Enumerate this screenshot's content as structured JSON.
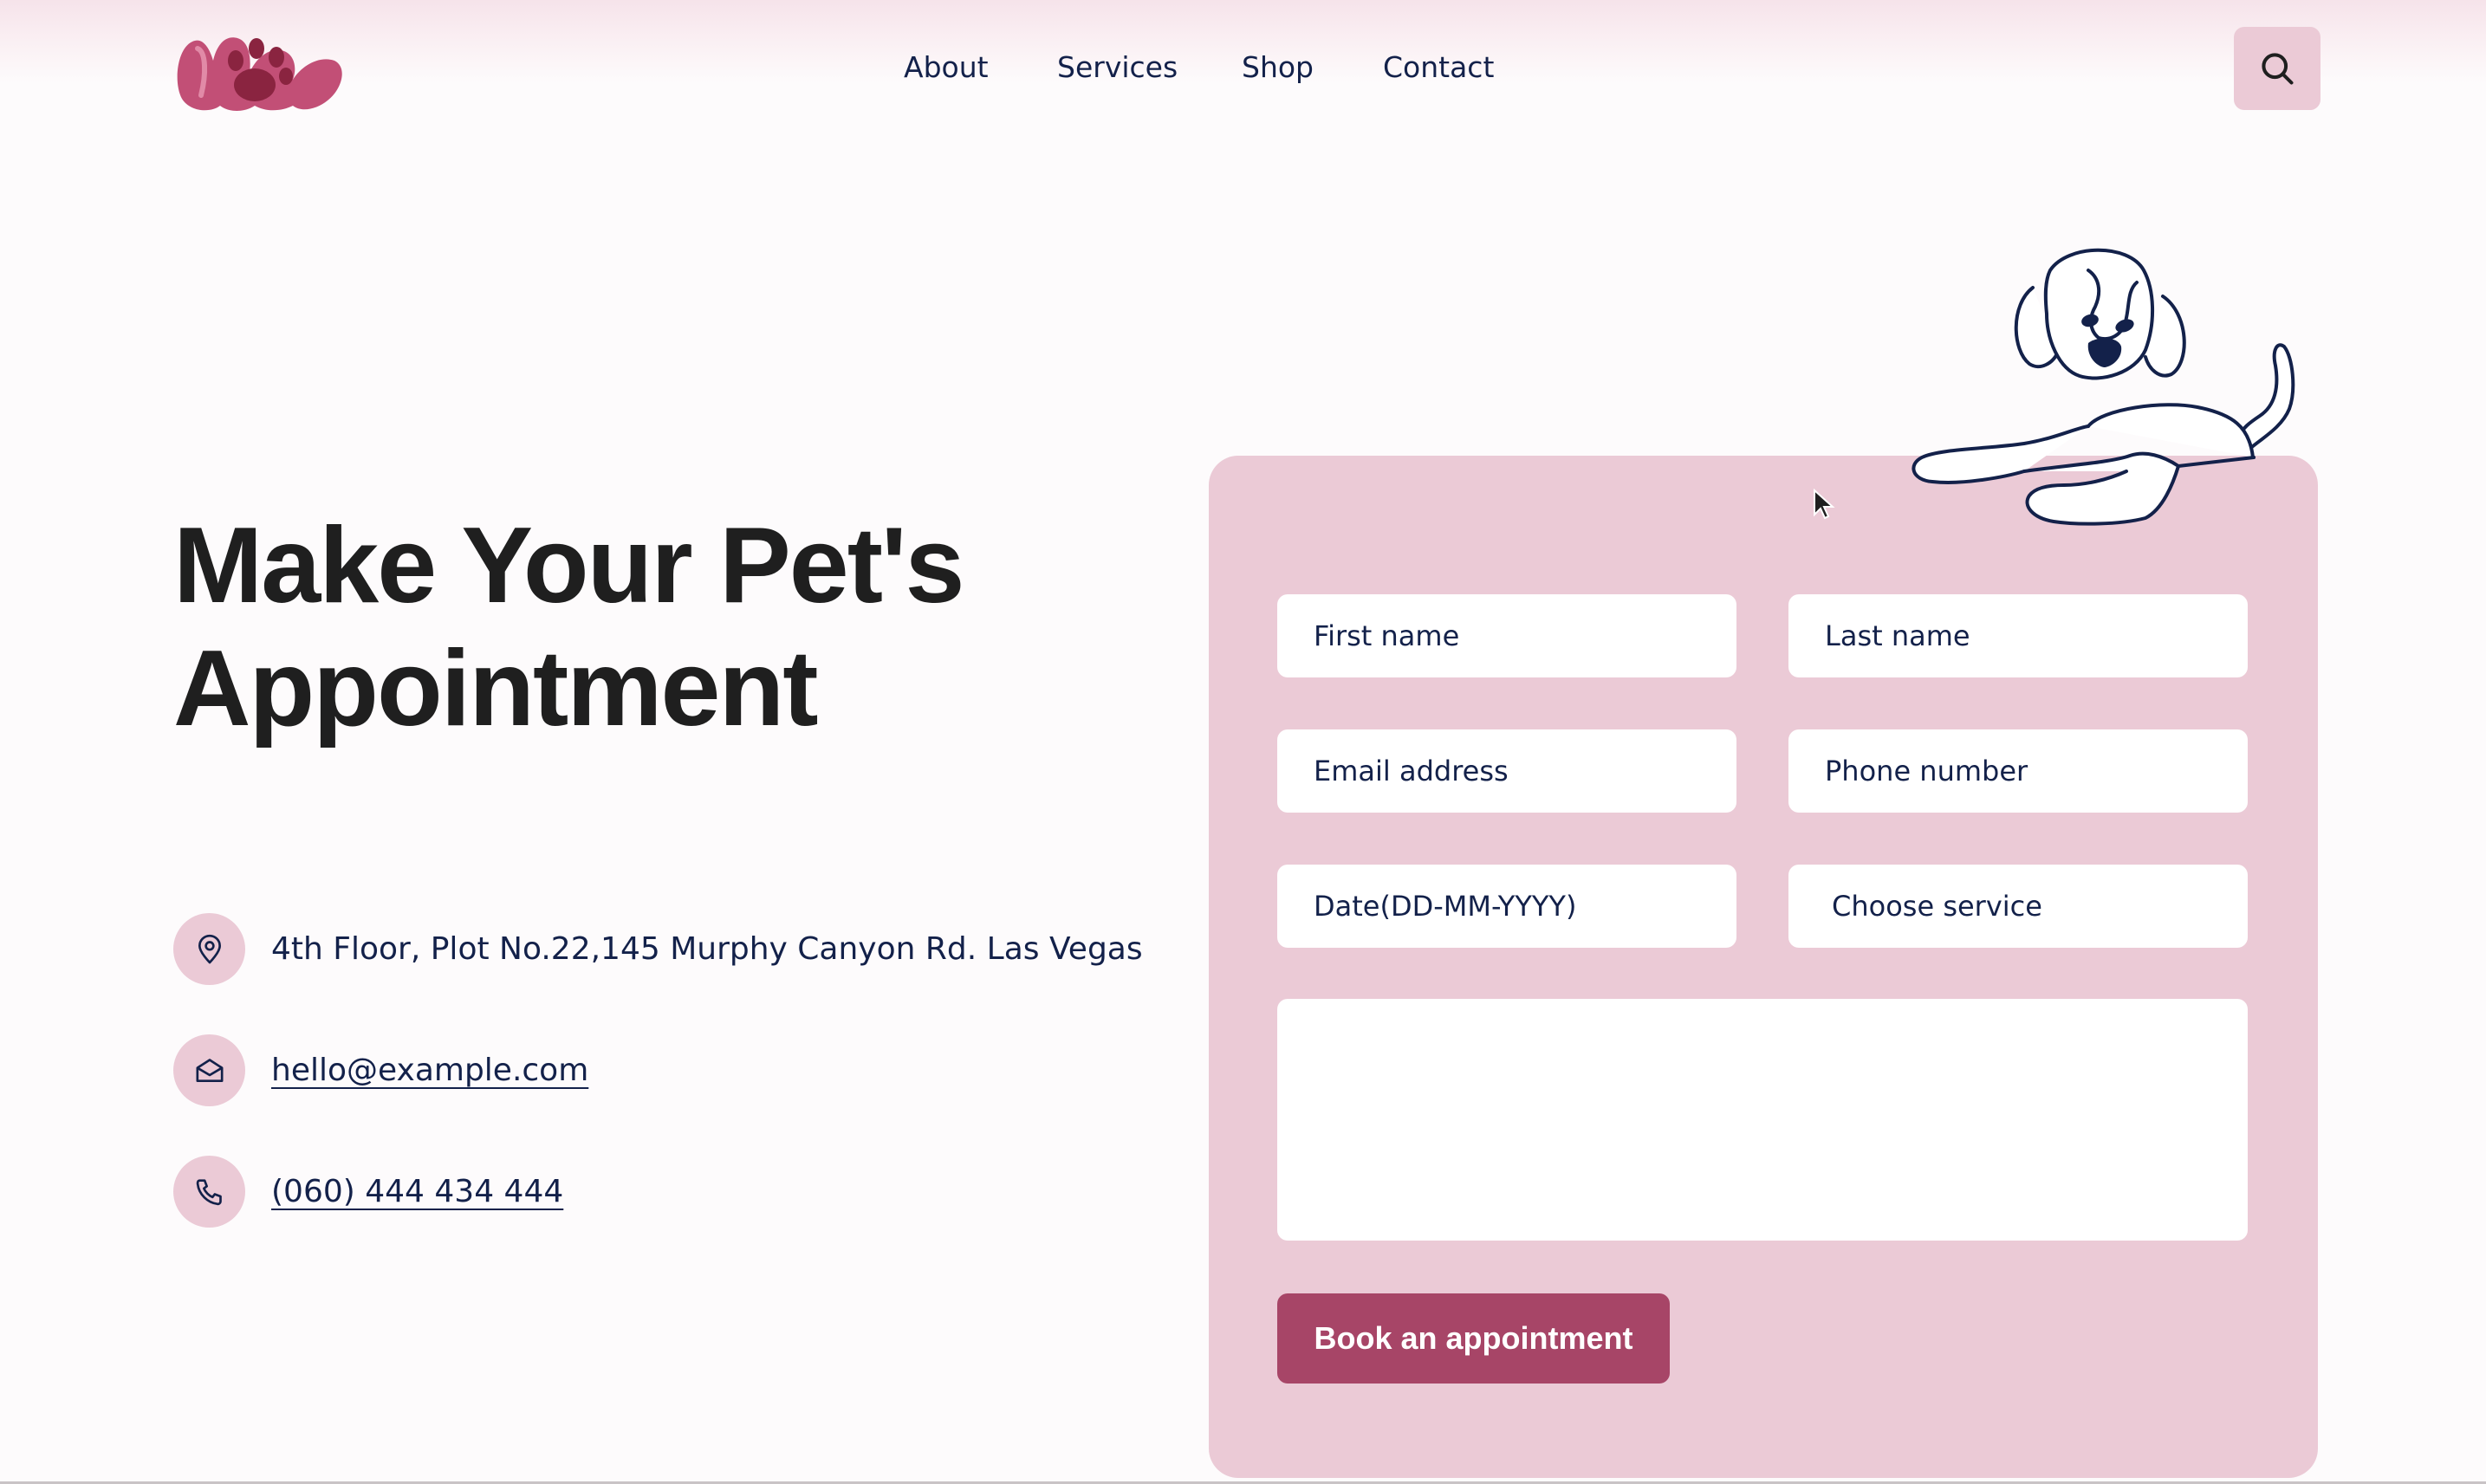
{
  "nav": {
    "items": [
      "About",
      "Services",
      "Shop",
      "Contact"
    ]
  },
  "hero": {
    "title_line1": "Make Your Pet's",
    "title_line2": "Appointment"
  },
  "contact": {
    "address": "4th Floor, Plot No.22,145 Murphy Canyon Rd. Las Vegas",
    "email": "hello@example.com",
    "phone": "(060) 444 434 444"
  },
  "form": {
    "first_name_placeholder": "First name",
    "last_name_placeholder": "Last name",
    "email_placeholder": "Email address",
    "phone_placeholder": "Phone number",
    "date_placeholder": "Date(DD-MM-YYYY)",
    "service_selected": "Choose service",
    "message_value": "",
    "submit_label": "Book an appointment"
  },
  "colors": {
    "card_bg": "#ebcad6",
    "accent_button": "#a74567",
    "text_navy": "#13214a",
    "heading": "#1f1f1f",
    "logo_pink": "#c24f76",
    "logo_paw": "#8a2440"
  },
  "icons": {
    "search": "search-icon",
    "address": "location-pin-icon",
    "email": "envelope-icon",
    "phone": "phone-icon",
    "illustration": "dog-illustration"
  }
}
